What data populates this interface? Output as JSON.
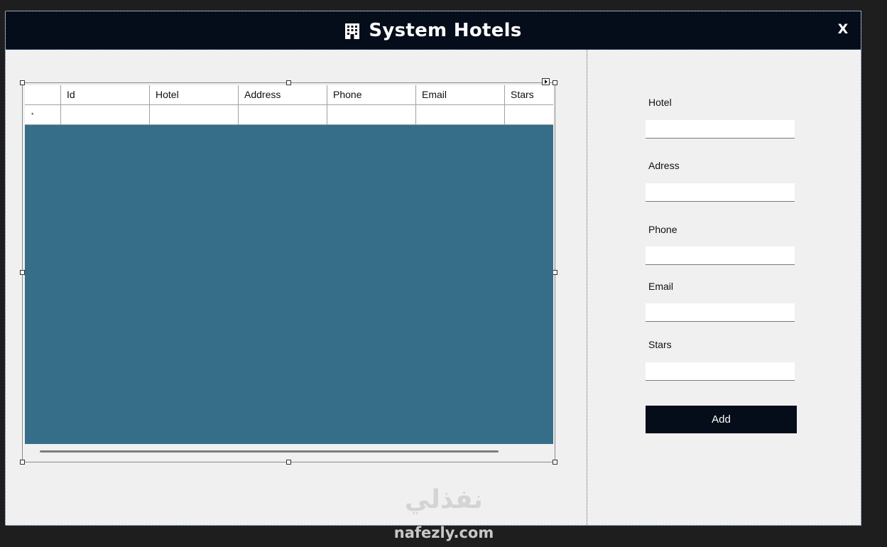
{
  "window": {
    "title": "System Hotels",
    "close_label": "X"
  },
  "grid": {
    "columns": [
      "Id",
      "Hotel",
      "Address",
      "Phone",
      "Email",
      "Stars"
    ],
    "new_row_marker": "*",
    "rows": []
  },
  "form": {
    "fields": [
      {
        "label": "Hotel",
        "value": ""
      },
      {
        "label": "Adress",
        "value": ""
      },
      {
        "label": "Phone",
        "value": ""
      },
      {
        "label": "Email",
        "value": ""
      },
      {
        "label": "Stars",
        "value": ""
      }
    ],
    "add_label": "Add"
  },
  "watermark": {
    "arabic": "نفذلي",
    "latin": "nafezly.com"
  },
  "colors": {
    "header_bg": "#050d1a",
    "grid_bg": "#366e8a",
    "form_bg": "#f0f0f0",
    "button_bg": "#050d1a"
  },
  "icons": {
    "title": "hotel-building-icon"
  }
}
